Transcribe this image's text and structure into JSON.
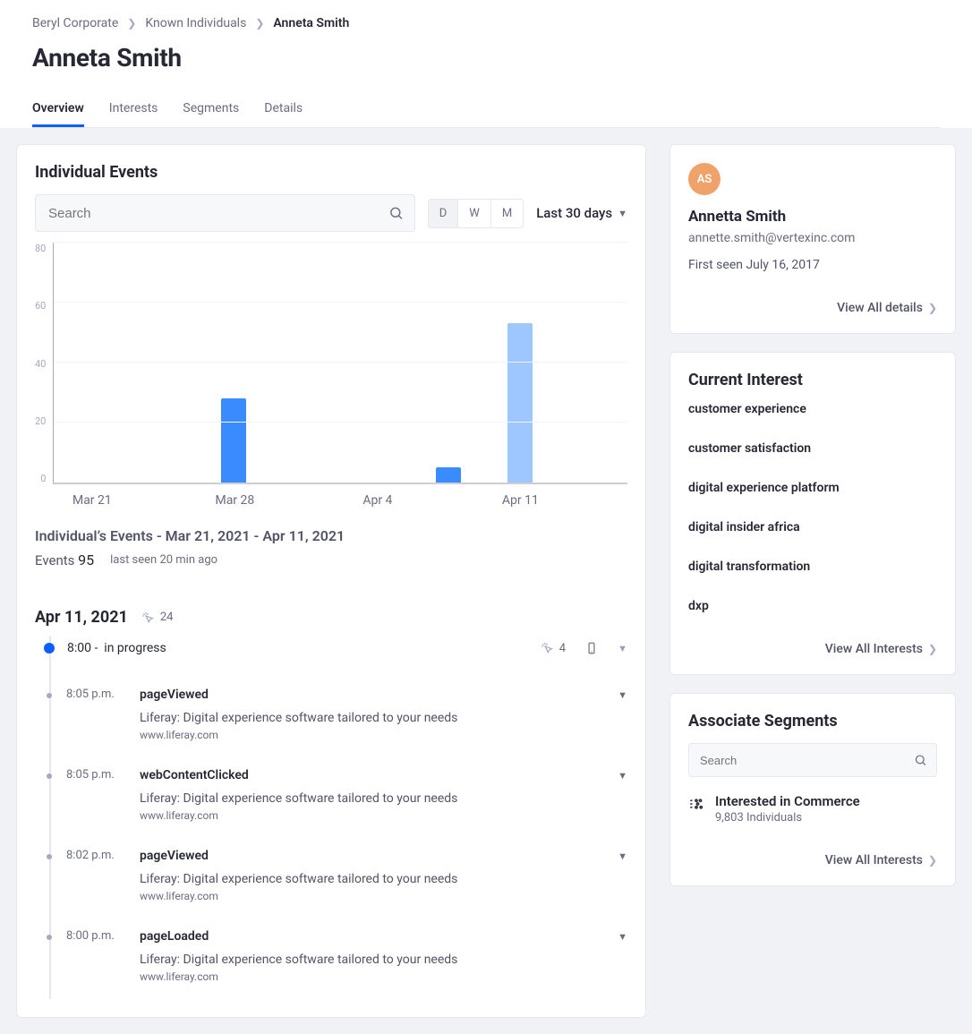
{
  "breadcrumb": {
    "root": "Beryl Corporate",
    "mid": "Known Individuals",
    "current": "Anneta Smith"
  },
  "page_title": "Anneta Smith",
  "tabs": [
    {
      "label": "Overview",
      "active": true
    },
    {
      "label": "Interests",
      "active": false
    },
    {
      "label": "Segments",
      "active": false
    },
    {
      "label": "Details",
      "active": false
    }
  ],
  "events_panel": {
    "title": "Individual Events",
    "search_placeholder": "Search",
    "period_buttons": [
      "D",
      "W",
      "M"
    ],
    "period_selected": "D",
    "range_label": "Last 30 days",
    "summary_title": "Individual’s Events - Mar 21, 2021 - Apr 11, 2021",
    "events_label": "Events",
    "events_count": "95",
    "last_seen": "last seen 20 min ago"
  },
  "chart_data": {
    "type": "bar",
    "categories": [
      "Mar 21",
      "Mar 28",
      "Apr 4",
      "Apr 11"
    ],
    "series": [
      {
        "name": "dark",
        "values": [
          0,
          28,
          5,
          0
        ],
        "color": "#3a8bfd"
      },
      {
        "name": "light",
        "values": [
          0,
          0,
          0,
          53
        ],
        "color": "#9fc7ff"
      }
    ],
    "xlabel": "",
    "ylabel": "",
    "ylim": [
      0,
      80
    ],
    "yticks": [
      0,
      20,
      40,
      60,
      80
    ]
  },
  "timeline": {
    "date": "Apr 11, 2021",
    "day_count": "24",
    "session": {
      "time": "8:00 -",
      "status": "in progress",
      "count": "4"
    },
    "events": [
      {
        "time": "8:05 p.m.",
        "name": "pageViewed",
        "desc": "Liferay: Digital experience software tailored to your needs",
        "url": "www.liferay.com"
      },
      {
        "time": "8:05 p.m.",
        "name": "webContentClicked",
        "desc": "Liferay: Digital experience software tailored to your needs",
        "url": "www.liferay.com"
      },
      {
        "time": "8:02 p.m.",
        "name": "pageViewed",
        "desc": "Liferay: Digital experience software tailored to your needs",
        "url": "www.liferay.com"
      },
      {
        "time": "8:00 p.m.",
        "name": "pageLoaded",
        "desc": "Liferay: Digital experience software tailored to your needs",
        "url": "www.liferay.com"
      }
    ]
  },
  "identity": {
    "initials": "AS",
    "name": "Annetta Smith",
    "email": "annette.smith@vertexinc.com",
    "first_seen": "First seen July 16, 2017",
    "view_all": "View All details"
  },
  "interests": {
    "title": "Current Interest",
    "items": [
      "customer experience",
      "customer satisfaction",
      "digital experience platform",
      "digital insider africa",
      "digital transformation",
      "dxp"
    ],
    "view_all": "View All Interests"
  },
  "segments": {
    "title": "Associate Segments",
    "search_placeholder": "Search",
    "items": [
      {
        "name": "Interested in Commerce",
        "count": "9,803 Individuals"
      }
    ],
    "view_all": "View All Interests"
  }
}
